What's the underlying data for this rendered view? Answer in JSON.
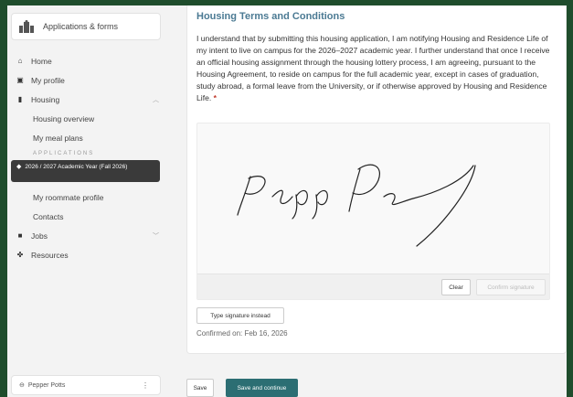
{
  "sidebar": {
    "app_title": "Applications & forms",
    "items": [
      {
        "label": "Home",
        "icon": "home-icon"
      },
      {
        "label": "My profile",
        "icon": "profile-icon"
      },
      {
        "label": "Housing",
        "icon": "building-icon"
      },
      {
        "label": "Housing overview"
      },
      {
        "label": "My meal plans"
      },
      {
        "label": "My roommate profile"
      },
      {
        "label": "Contacts"
      },
      {
        "label": "Jobs",
        "icon": "briefcase-icon"
      },
      {
        "label": "Resources",
        "icon": "resources-icon"
      }
    ],
    "section_label": "APPLICATIONS",
    "active_item": "2026 / 2027 Academic Year (Fall 2026)",
    "user_name": "Pepper Potts"
  },
  "main": {
    "title": "Housing Terms and Conditions",
    "terms_text": "I understand that by submitting this housing application, I am notifying Housing and Residence Life of my intent to live on campus for the 2026–2027 academic year. I further understand that once I receive an official housing assignment through the housing lottery process, I am agreeing, pursuant to the Housing Agreement, to reside on campus for the full academic year, except in cases of graduation, study abroad, a formal leave from the University, or if otherwise approved by Housing and Residence Life.",
    "required_mark": "*",
    "clear_label": "Clear",
    "confirm_label": "Confirm signature",
    "type_signature_label": "Type signature instead",
    "confirmed_text": "Confirmed on: Feb 16, 2026"
  },
  "footer": {
    "save_label": "Save",
    "continue_label": "Save and continue"
  },
  "colors": {
    "background": "#1f4d2c",
    "accent": "#2c6e73",
    "title": "#4b7a93",
    "active_nav": "#3a3a3a"
  }
}
